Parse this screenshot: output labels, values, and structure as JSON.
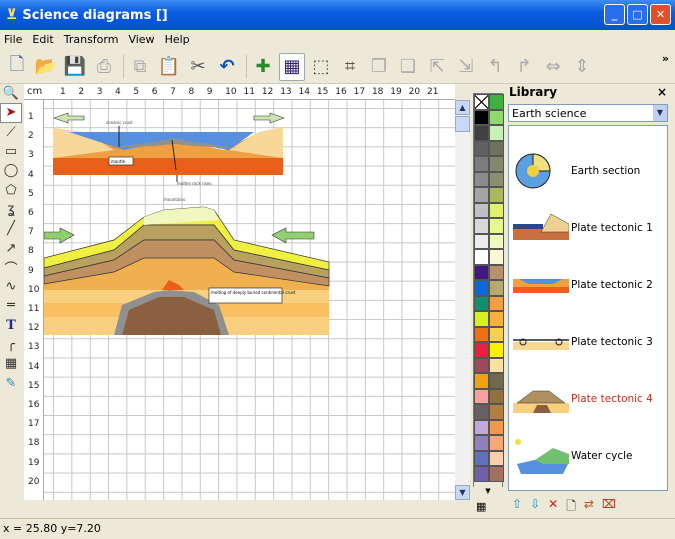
{
  "window": {
    "title": "Science diagrams []"
  },
  "menu": [
    "File",
    "Edit",
    "Transform",
    "View",
    "Help"
  ],
  "toolbar": {
    "icons": [
      "new-icon",
      "open-icon",
      "save-icon",
      "print-icon",
      "copy-icon",
      "paste-icon",
      "cut-icon",
      "undo-icon",
      "snap-icon",
      "grid-icon",
      "group-icon",
      "ungroup-icon",
      "bring-front-icon",
      "send-back-icon",
      "bring-forward-icon",
      "send-backward-icon",
      "rotate-left-icon",
      "rotate-right-icon",
      "flip-horizontal-icon",
      "flip-vertical-icon"
    ],
    "more": "»"
  },
  "tools": [
    "zoom-icon",
    "pointer-icon",
    "node-edit-icon",
    "rectangle-icon",
    "ellipse-icon",
    "polygon-icon",
    "freehand-icon",
    "line-icon",
    "arrow-icon",
    "curve-icon",
    "wave-icon",
    "double-line-icon",
    "text-icon",
    "connector-icon",
    "table-icon",
    "eyedropper-icon"
  ],
  "ruler": {
    "unit": "cm",
    "h": [
      "1",
      "2",
      "3",
      "4",
      "5",
      "6",
      "7",
      "8",
      "9",
      "10",
      "11",
      "12",
      "13",
      "14",
      "15",
      "16",
      "17",
      "18",
      "19",
      "20",
      "21"
    ],
    "v": [
      "1",
      "2",
      "3",
      "4",
      "5",
      "6",
      "7",
      "8",
      "9",
      "10",
      "11",
      "12",
      "13",
      "14",
      "15",
      "16",
      "17",
      "18",
      "19",
      "20"
    ]
  },
  "diagram": {
    "labels": {
      "oceanic": "oceanic crust",
      "mantle": "mantle",
      "molten": "molten rock rises",
      "mountains": "mountains",
      "melting": "melting of deeply buried continental crust"
    }
  },
  "palette": {
    "left": [
      "#000000",
      "#404040",
      "#606060",
      "#7c7c7c",
      "#8c8c8c",
      "#a4a4a4",
      "#c0c0c0",
      "#d8d8d8",
      "#ececec",
      "#ffffff",
      "#401880",
      "#0868e0",
      "#109070",
      "#d8f020",
      "#f07010",
      "#e82040",
      "#a04860",
      "#f0a010",
      "#f8a0a0",
      "#686060",
      "#c0a8d8",
      "#9080c0",
      "#6070c0",
      "#7060a8"
    ],
    "right": [
      "#40b040",
      "#90d870",
      "#c8f0b8",
      "#707060",
      "#808870",
      "#889070",
      "#a8b860",
      "#e0f070",
      "#e8f890",
      "#f0f8c0",
      "#f8f8d8",
      "#b89070",
      "#b8a870",
      "#f0a040",
      "#f8b040",
      "#f8d050",
      "#f8f000",
      "#f8e0a0",
      "#706850",
      "#907040",
      "#b08040",
      "#f09850",
      "#f8a878",
      "#f8d0b0",
      "#a07060"
    ]
  },
  "library": {
    "title": "Library",
    "close": "×",
    "category": "Earth science",
    "items": [
      {
        "label": "Earth section"
      },
      {
        "label": "Plate tectonic 1"
      },
      {
        "label": "Plate tectonic 2"
      },
      {
        "label": "Plate tectonic 3"
      },
      {
        "label": "Plate tectonic 4",
        "selected": true
      },
      {
        "label": "Water cycle"
      }
    ],
    "selected_color": "#c03020"
  },
  "status": {
    "coords": "x = 25.80 y=7.20"
  }
}
